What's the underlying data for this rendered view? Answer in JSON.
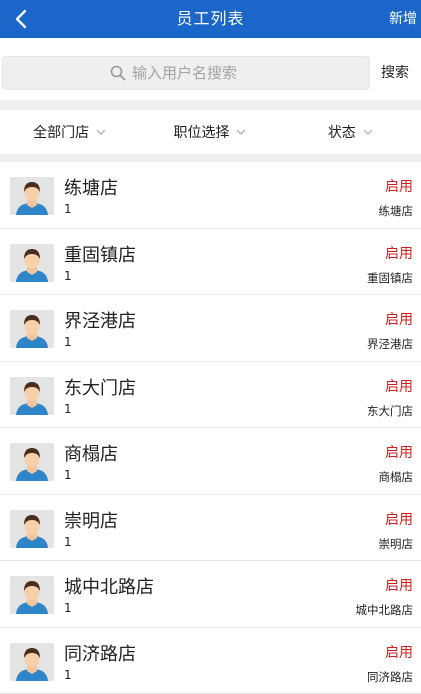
{
  "header": {
    "title": "员工列表",
    "add_label": "新增",
    "back_icon": "chevron-left-icon"
  },
  "search": {
    "placeholder": "输入用户名搜索",
    "button_label": "搜索"
  },
  "filters": [
    {
      "label": "全部门店"
    },
    {
      "label": "职位选择"
    },
    {
      "label": "状态"
    }
  ],
  "colors": {
    "header": "#1a67c9",
    "status": "#d11f1f"
  },
  "employees": [
    {
      "name": "练塘店",
      "num": "1",
      "status": "启用",
      "store": "练塘店"
    },
    {
      "name": "重固镇店",
      "num": "1",
      "status": "启用",
      "store": "重固镇店"
    },
    {
      "name": "界泾港店",
      "num": "1",
      "status": "启用",
      "store": "界泾港店"
    },
    {
      "name": "东大门店",
      "num": "1",
      "status": "启用",
      "store": "东大门店"
    },
    {
      "name": "商榻店",
      "num": "1",
      "status": "启用",
      "store": "商榻店"
    },
    {
      "name": "崇明店",
      "num": "1",
      "status": "启用",
      "store": "崇明店"
    },
    {
      "name": "城中北路店",
      "num": "1",
      "status": "启用",
      "store": "城中北路店"
    },
    {
      "name": "同济路店",
      "num": "1",
      "status": "启用",
      "store": "同济路店"
    }
  ]
}
